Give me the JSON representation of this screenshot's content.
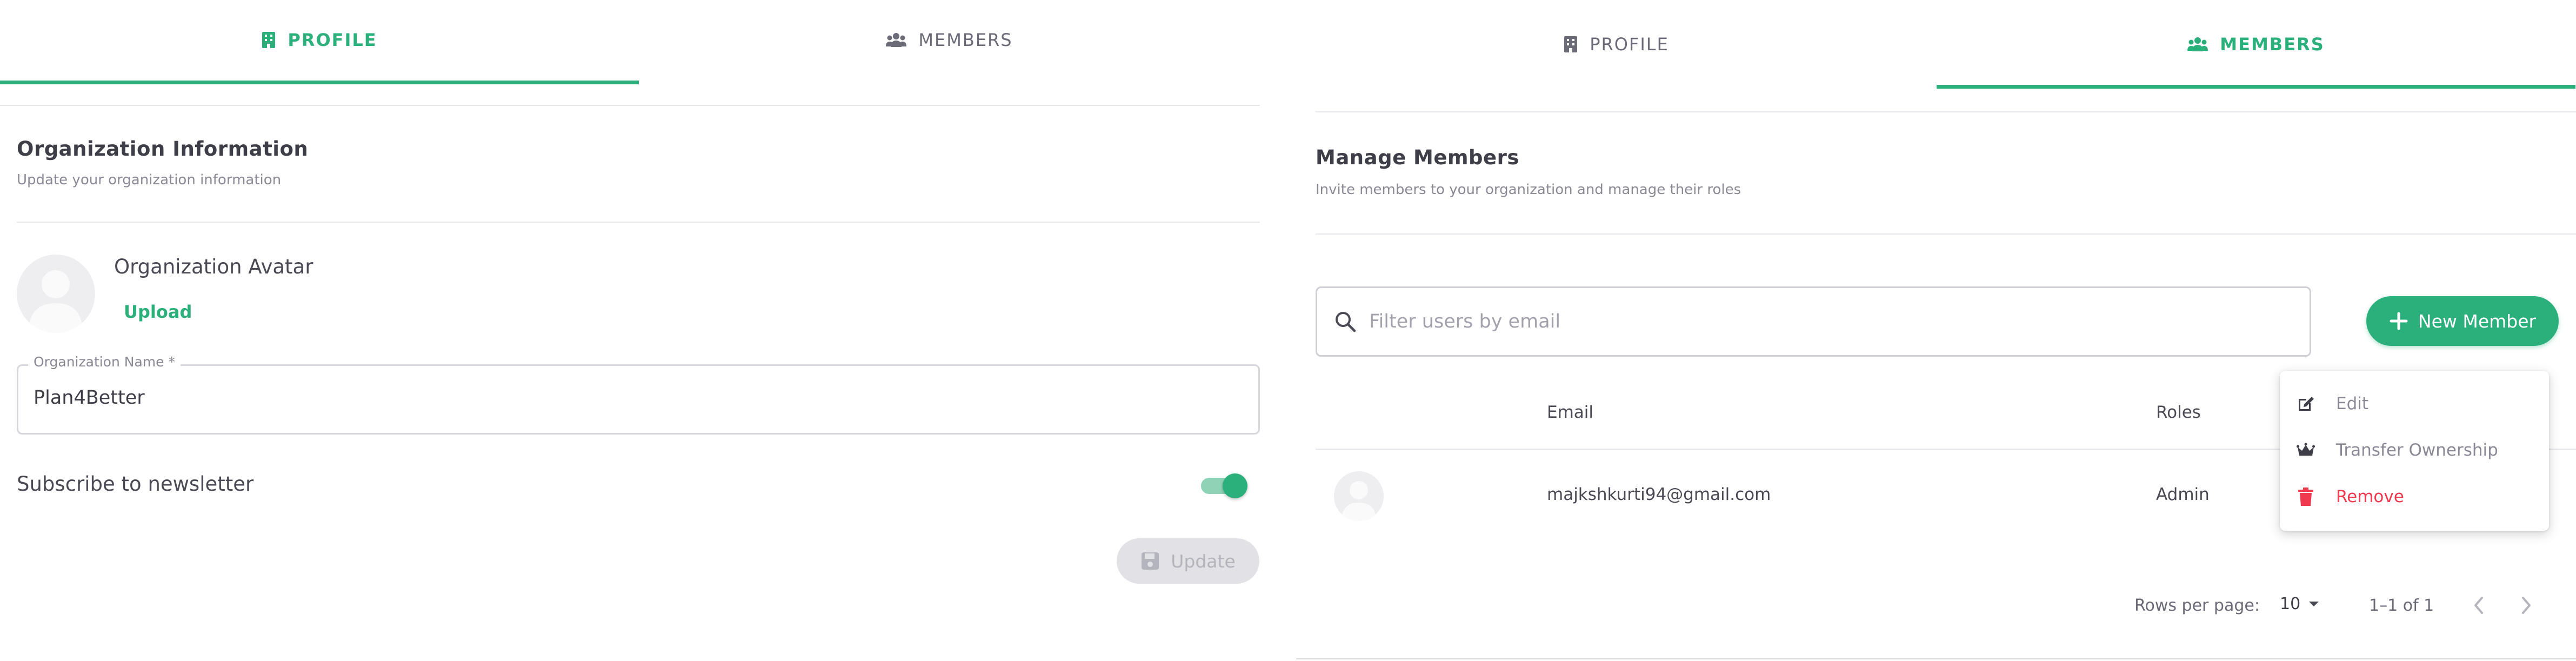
{
  "left_panel": {
    "tabs": [
      {
        "label": "PROFILE",
        "icon": "building-icon",
        "active": true
      },
      {
        "label": "MEMBERS",
        "icon": "users-icon",
        "active": false
      }
    ],
    "section": {
      "title": "Organization Information",
      "subtitle": "Update your organization information"
    },
    "avatar": {
      "label": "Organization Avatar",
      "upload_label": "Upload"
    },
    "org_name_field": {
      "label": "Organization Name *",
      "value": "Plan4Better"
    },
    "newsletter": {
      "label": "Subscribe to newsletter",
      "enabled": true
    },
    "update_button": {
      "label": "Update",
      "icon": "save-icon",
      "disabled": true
    }
  },
  "right_panel": {
    "tabs": [
      {
        "label": "PROFILE",
        "icon": "building-icon",
        "active": false
      },
      {
        "label": "MEMBERS",
        "icon": "users-icon",
        "active": true
      }
    ],
    "section": {
      "title": "Manage Members",
      "subtitle": "Invite members to your organization and manage their roles"
    },
    "search": {
      "placeholder": "Filter users by email",
      "value": ""
    },
    "new_member_button": {
      "label": "New Member",
      "icon": "plus-icon"
    },
    "table": {
      "columns": [
        "",
        "Email",
        "Roles"
      ],
      "rows": [
        {
          "email": "majkshkurti94@gmail.com",
          "role": "Admin"
        }
      ]
    },
    "context_menu": {
      "items": [
        {
          "label": "Edit",
          "icon": "edit-icon"
        },
        {
          "label": "Transfer Ownership",
          "icon": "crown-icon"
        },
        {
          "label": "Remove",
          "icon": "trash-icon",
          "danger": true
        }
      ]
    },
    "pagination": {
      "rows_per_page_label": "Rows per page:",
      "rows_per_page_value": "10",
      "range": "1–1 of 1"
    }
  },
  "colors": {
    "accent": "#2bb07c",
    "danger": "#f0394e",
    "text": "#4a4a55",
    "muted": "#8a8a96"
  }
}
